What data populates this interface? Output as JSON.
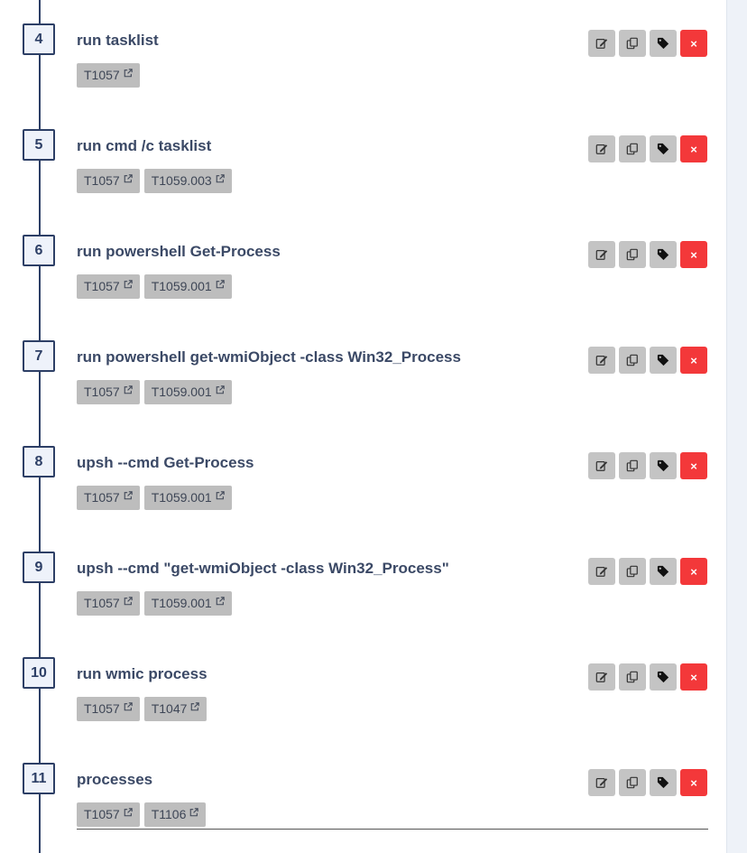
{
  "steps": [
    {
      "number": "4",
      "command": "run tasklist",
      "tags": [
        "T1057"
      ]
    },
    {
      "number": "5",
      "command": "run cmd /c tasklist",
      "tags": [
        "T1057",
        "T1059.003"
      ]
    },
    {
      "number": "6",
      "command": "run powershell Get-Process",
      "tags": [
        "T1057",
        "T1059.001"
      ]
    },
    {
      "number": "7",
      "command": "run powershell get-wmiObject -class Win32_Process",
      "tags": [
        "T1057",
        "T1059.001"
      ]
    },
    {
      "number": "8",
      "command": "upsh --cmd Get-Process",
      "tags": [
        "T1057",
        "T1059.001"
      ]
    },
    {
      "number": "9",
      "command": "upsh --cmd \"get-wmiObject -class Win32_Process\"",
      "tags": [
        "T1057",
        "T1059.001"
      ]
    },
    {
      "number": "10",
      "command": "run wmic process",
      "tags": [
        "T1057",
        "T1047"
      ]
    },
    {
      "number": "11",
      "command": "processes",
      "tags": [
        "T1057",
        "T1106"
      ]
    }
  ],
  "actions": {
    "edit_icon": "edit-icon",
    "copy_icon": "copy-icon",
    "tag_icon": "tag-icon",
    "delete_label": "×"
  },
  "colors": {
    "step_border": "#2d3f66",
    "tag_bg": "#bdbdbd",
    "action_bg": "#c4c4c4",
    "delete_bg": "#f3383a"
  }
}
